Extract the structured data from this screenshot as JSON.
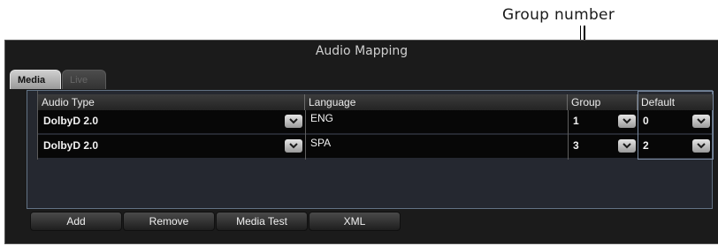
{
  "annotation": {
    "label": "Group number"
  },
  "window": {
    "title": "Audio Mapping"
  },
  "tabs": [
    {
      "label": "Media",
      "active": true
    },
    {
      "label": "Live",
      "active": false
    }
  ],
  "table": {
    "columns": [
      "Audio Type",
      "Language",
      "Group",
      "Default"
    ],
    "rows": [
      {
        "audio_type": "DolbyD 2.0",
        "language": "ENG",
        "group": "1",
        "default": "0"
      },
      {
        "audio_type": "DolbyD 2.0",
        "language": "SPA",
        "group": "3",
        "default": "2"
      }
    ]
  },
  "buttons": {
    "add": "Add",
    "remove": "Remove",
    "media_test": "Media Test",
    "xml": "XML"
  },
  "colors": {
    "panel_bg": "#1b1b1b",
    "content_bg": "#252830",
    "row_bg": "#070707",
    "content_border": "#627284"
  },
  "icons": {
    "dropdown": "chevron-down-icon"
  }
}
